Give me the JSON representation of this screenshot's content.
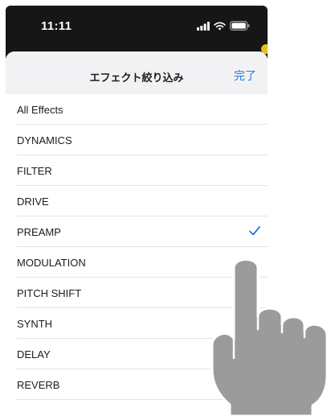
{
  "status_bar": {
    "time": "11:11",
    "icons": [
      "cellular-signal-icon",
      "wifi-icon",
      "battery-icon"
    ]
  },
  "sheet": {
    "title": "エフェクト絞り込み",
    "done_label": "完了"
  },
  "filters": [
    {
      "label": "All Effects",
      "selected": false
    },
    {
      "label": "DYNAMICS",
      "selected": false
    },
    {
      "label": "FILTER",
      "selected": false
    },
    {
      "label": "DRIVE",
      "selected": false
    },
    {
      "label": "PREAMP",
      "selected": true
    },
    {
      "label": "MODULATION",
      "selected": false
    },
    {
      "label": "PITCH SHIFT",
      "selected": false
    },
    {
      "label": "SYNTH",
      "selected": false
    },
    {
      "label": "DELAY",
      "selected": false
    },
    {
      "label": "REVERB",
      "selected": false
    }
  ],
  "colors": {
    "accent": "#1e7ae6",
    "header_background": "#f2f2f4",
    "phone_background": "#161616",
    "hand": "#9b9b9b"
  },
  "overlay": {
    "icon": "pointing-hand-icon"
  }
}
